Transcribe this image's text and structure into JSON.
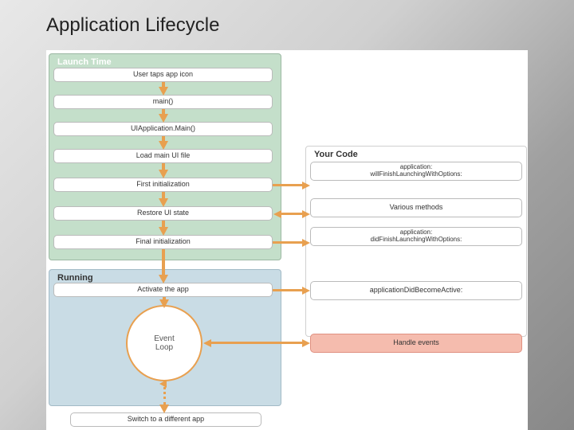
{
  "title": "Application Lifecycle",
  "panels": {
    "launch": {
      "title": "Launch Time"
    },
    "running": {
      "title": "Running"
    },
    "yourcode": {
      "title": "Your Code"
    }
  },
  "steps": {
    "tap": "User taps app icon",
    "main": "main()",
    "uiappmain": "UIApplication.Main()",
    "loadui": "Load main UI file",
    "firstinit": "First initialization",
    "restore": "Restore UI state",
    "finalinit": "Final initialization",
    "activate": "Activate the app",
    "switch": "Switch to a different app"
  },
  "loop": {
    "label": "Event\nLoop"
  },
  "code": {
    "willfinish": "application:\nwillFinishLaunchingWithOptions:",
    "various": "Various methods",
    "didfinish": "application:\ndidFinishLaunchingWithOptions:",
    "didactive": "applicationDidBecomeActive:",
    "handle": "Handle events"
  }
}
